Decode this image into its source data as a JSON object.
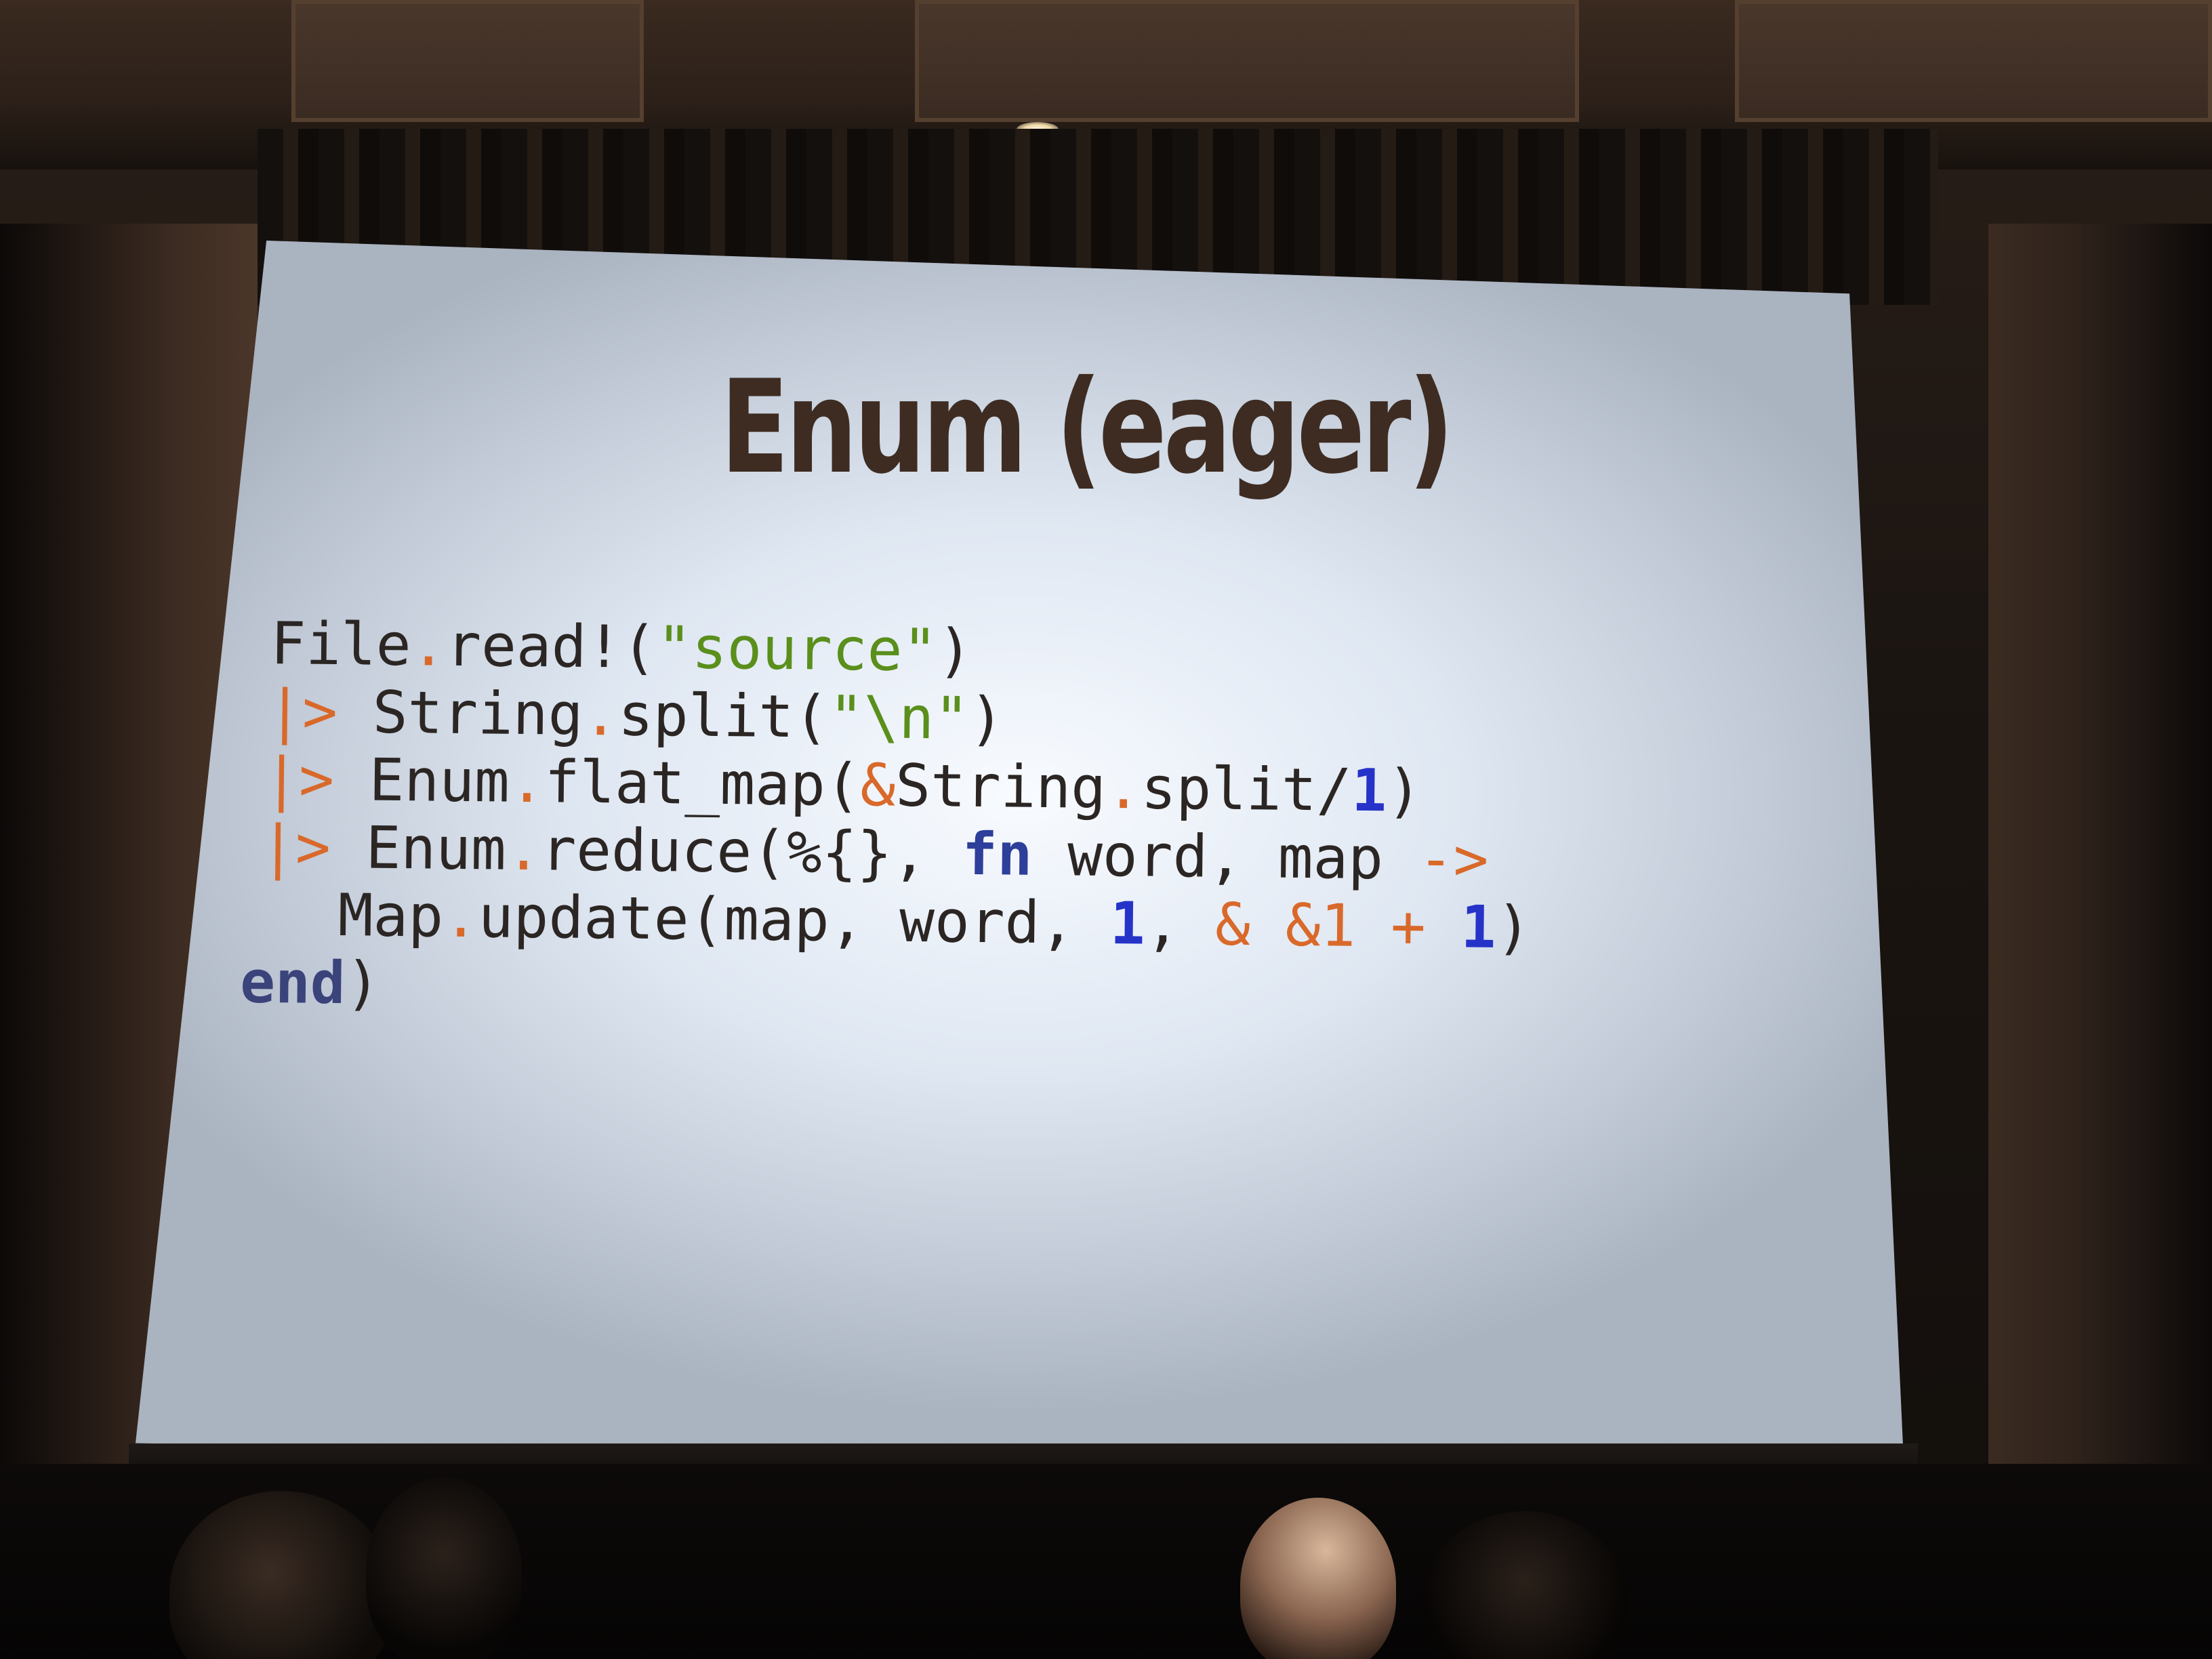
{
  "slide": {
    "title": "Enum (eager)",
    "code": [
      [
        {
          "t": "File",
          "c": ""
        },
        {
          "t": ".",
          "c": "k-op"
        },
        {
          "t": "read!(",
          "c": ""
        },
        {
          "t": "\"source\"",
          "c": "k-str"
        },
        {
          "t": ")",
          "c": ""
        }
      ],
      [
        {
          "t": "|>",
          "c": "k-op"
        },
        {
          "t": " String",
          "c": ""
        },
        {
          "t": ".",
          "c": "k-op"
        },
        {
          "t": "split(",
          "c": ""
        },
        {
          "t": "\"\\n\"",
          "c": "k-str"
        },
        {
          "t": ")",
          "c": ""
        }
      ],
      [
        {
          "t": "|>",
          "c": "k-op"
        },
        {
          "t": " Enum",
          "c": ""
        },
        {
          "t": ".",
          "c": "k-op"
        },
        {
          "t": "flat_map(",
          "c": ""
        },
        {
          "t": "&",
          "c": "k-op"
        },
        {
          "t": "String",
          "c": ""
        },
        {
          "t": ".",
          "c": "k-op"
        },
        {
          "t": "split/",
          "c": ""
        },
        {
          "t": "1",
          "c": "k-num"
        },
        {
          "t": ")",
          "c": ""
        }
      ],
      [
        {
          "t": "|>",
          "c": "k-op"
        },
        {
          "t": " Enum",
          "c": ""
        },
        {
          "t": ".",
          "c": "k-op"
        },
        {
          "t": "reduce(%{}, ",
          "c": ""
        },
        {
          "t": "fn",
          "c": "k-kw"
        },
        {
          "t": " word, map ",
          "c": ""
        },
        {
          "t": "->",
          "c": "k-op"
        }
      ],
      [
        {
          "t": "  Map",
          "c": ""
        },
        {
          "t": ".",
          "c": "k-op"
        },
        {
          "t": "update(map, word, ",
          "c": ""
        },
        {
          "t": "1",
          "c": "k-num"
        },
        {
          "t": ", ",
          "c": ""
        },
        {
          "t": "&",
          "c": "k-op"
        },
        {
          "t": " ",
          "c": ""
        },
        {
          "t": "&1",
          "c": "k-op"
        },
        {
          "t": " ",
          "c": ""
        },
        {
          "t": "+",
          "c": "k-op"
        },
        {
          "t": " ",
          "c": ""
        },
        {
          "t": "1",
          "c": "k-num"
        },
        {
          "t": ")",
          "c": ""
        }
      ],
      [
        {
          "t": "end",
          "c": "k-end"
        },
        {
          "t": ")",
          "c": ""
        }
      ]
    ]
  },
  "colors": {
    "title": "#3e2c22",
    "operator": "#d9692a",
    "string": "#5a8f1c",
    "keyword": "#2d3f9a",
    "number": "#2533c8"
  }
}
